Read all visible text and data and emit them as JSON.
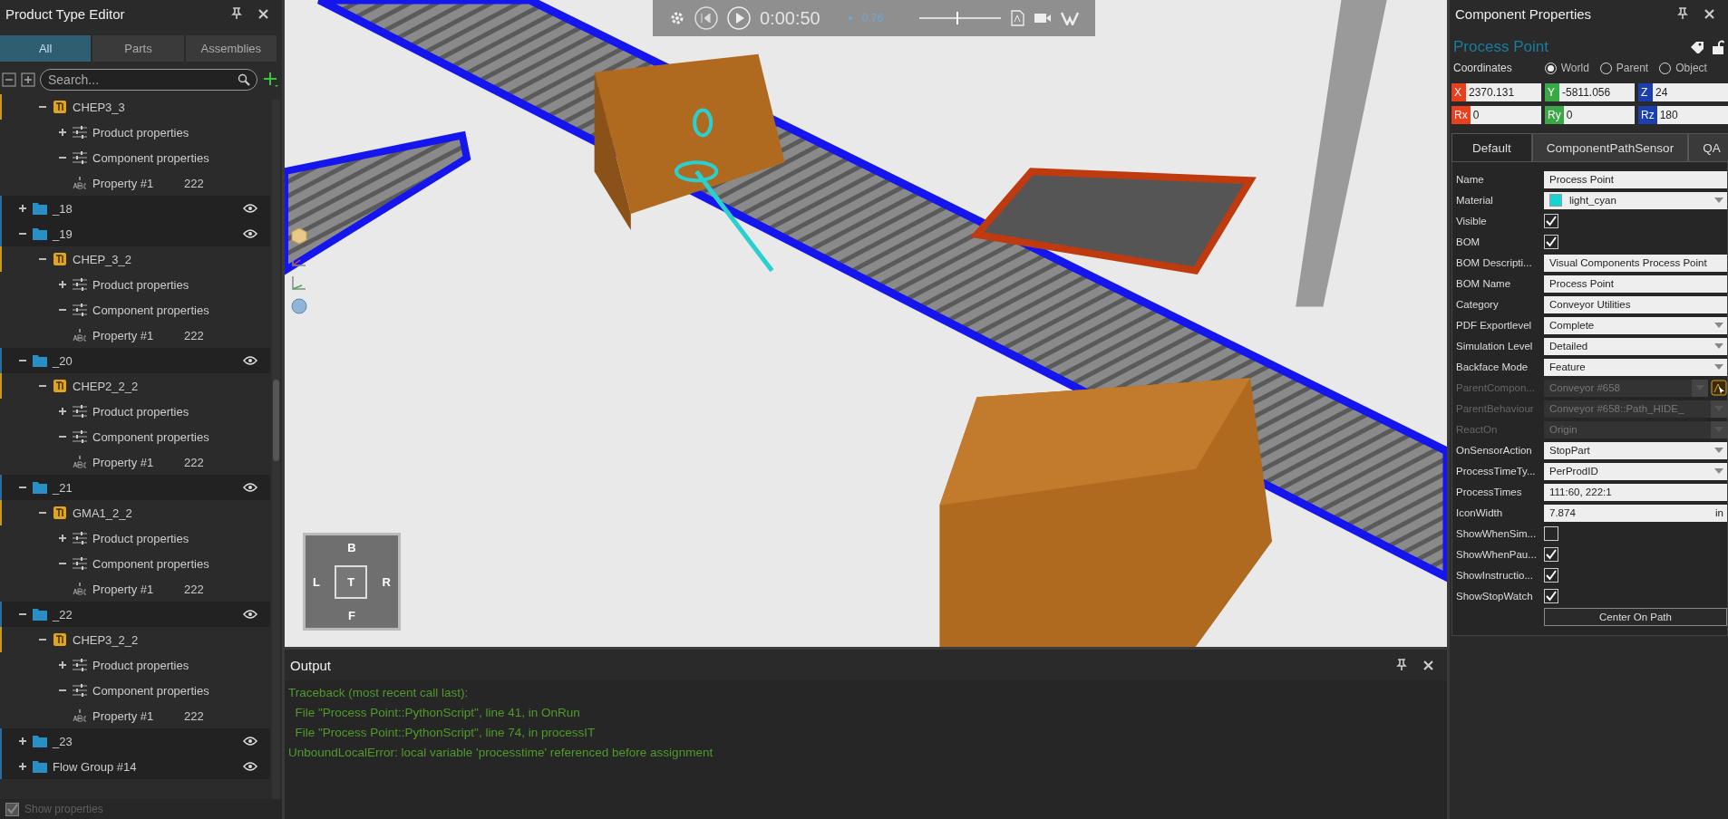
{
  "product_type_editor": {
    "title": "Product Type Editor",
    "tabs": [
      {
        "label": "All",
        "selected": true
      },
      {
        "label": "Parts",
        "selected": false
      },
      {
        "label": "Assemblies",
        "selected": false
      }
    ],
    "search": {
      "placeholder": "Search..."
    },
    "tree": [
      {
        "kind": "product",
        "label": "CHEP3_3",
        "expanded": true,
        "children": [
          {
            "kind": "group",
            "label": "Product properties",
            "expanded": false
          },
          {
            "kind": "group",
            "label": "Component properties",
            "expanded": true,
            "children": [
              {
                "kind": "property",
                "label": "Property #1",
                "value": "222"
              }
            ]
          }
        ]
      },
      {
        "kind": "folder",
        "label": "_18",
        "expanded": false
      },
      {
        "kind": "folder",
        "label": "_19",
        "expanded": true,
        "children": [
          {
            "kind": "product",
            "label": "CHEP_3_2",
            "expanded": true,
            "children": [
              {
                "kind": "group",
                "label": "Product properties",
                "expanded": false
              },
              {
                "kind": "group",
                "label": "Component properties",
                "expanded": true,
                "children": [
                  {
                    "kind": "property",
                    "label": "Property #1",
                    "value": "222"
                  }
                ]
              }
            ]
          }
        ]
      },
      {
        "kind": "folder",
        "label": "_20",
        "expanded": true,
        "children": [
          {
            "kind": "product",
            "label": "CHEP2_2_2",
            "expanded": true,
            "children": [
              {
                "kind": "group",
                "label": "Product properties",
                "expanded": false
              },
              {
                "kind": "group",
                "label": "Component properties",
                "expanded": true,
                "children": [
                  {
                    "kind": "property",
                    "label": "Property #1",
                    "value": "222"
                  }
                ]
              }
            ]
          }
        ]
      },
      {
        "kind": "folder",
        "label": "_21",
        "expanded": true,
        "children": [
          {
            "kind": "product",
            "label": "GMA1_2_2",
            "expanded": true,
            "children": [
              {
                "kind": "group",
                "label": "Product properties",
                "expanded": false
              },
              {
                "kind": "group",
                "label": "Component properties",
                "expanded": true,
                "children": [
                  {
                    "kind": "property",
                    "label": "Property #1",
                    "value": "222"
                  }
                ]
              }
            ]
          }
        ]
      },
      {
        "kind": "folder",
        "label": "_22",
        "expanded": true,
        "children": [
          {
            "kind": "product",
            "label": "CHEP3_2_2",
            "expanded": true,
            "children": [
              {
                "kind": "group",
                "label": "Product properties",
                "expanded": false
              },
              {
                "kind": "group",
                "label": "Component properties",
                "expanded": true,
                "children": [
                  {
                    "kind": "property",
                    "label": "Property #1",
                    "value": "222"
                  }
                ]
              }
            ]
          }
        ]
      },
      {
        "kind": "folder",
        "label": "_23",
        "expanded": false
      },
      {
        "kind": "folder",
        "label": "Flow Group #14",
        "expanded": false
      }
    ],
    "show_properties": {
      "label": "Show properties",
      "checked": true,
      "disabled": true
    }
  },
  "viewport": {
    "playback": {
      "time": "0:00:50",
      "speed": "0.76",
      "level": 0.45
    },
    "view_cube": {
      "top": "B",
      "left": "L",
      "center": "T",
      "right": "R",
      "bottom": "F"
    }
  },
  "output": {
    "title": "Output",
    "lines": [
      "Traceback (most recent call last):",
      "  File \"Process Point::PythonScript\", line 41, in OnRun",
      "  File \"Process Point::PythonScript\", line 74, in processIT",
      "UnboundLocalError: local variable 'processtime' referenced before assignment"
    ]
  },
  "component_properties": {
    "title": "Component Properties",
    "component_name": "Process Point",
    "coordinates": {
      "label": "Coordinates",
      "options": [
        {
          "label": "World",
          "selected": true
        },
        {
          "label": "Parent",
          "selected": false
        },
        {
          "label": "Object",
          "selected": false
        }
      ],
      "fields": [
        {
          "axis": "X",
          "value": "2370.131",
          "color": "#e8401c"
        },
        {
          "axis": "Y",
          "value": "-5811.056",
          "color": "#3aa845"
        },
        {
          "axis": "Z",
          "value": "24",
          "color": "#1c3fb0"
        },
        {
          "axis": "Rx",
          "value": "0",
          "color": "#e8401c"
        },
        {
          "axis": "Ry",
          "value": "0",
          "color": "#3aa845"
        },
        {
          "axis": "Rz",
          "value": "180",
          "color": "#1c3fb0"
        }
      ]
    },
    "tabs": [
      {
        "label": "Default",
        "selected": true
      },
      {
        "label": "ComponentPathSensor",
        "selected": false
      },
      {
        "label": "QA",
        "selected": false
      }
    ],
    "properties": [
      {
        "kind": "text",
        "label": "Name",
        "value": "Process Point",
        "disabled": false
      },
      {
        "kind": "dropdown",
        "label": "Material",
        "value": "light_cyan",
        "color": "#16d4d4",
        "disabled": false
      },
      {
        "kind": "checkbox",
        "label": "Visible",
        "checked": true
      },
      {
        "kind": "checkbox",
        "label": "BOM",
        "checked": true
      },
      {
        "kind": "text",
        "label": "BOM Descripti...",
        "value": "Visual Components Process Point",
        "disabled": false
      },
      {
        "kind": "text",
        "label": "BOM Name",
        "value": "Process Point",
        "disabled": false
      },
      {
        "kind": "text",
        "label": "Category",
        "value": "Conveyor Utilities",
        "disabled": false
      },
      {
        "kind": "dropdown",
        "label": "PDF Exportlevel",
        "value": "Complete",
        "disabled": false
      },
      {
        "kind": "dropdown",
        "label": "Simulation Level",
        "value": "Detailed",
        "disabled": false
      },
      {
        "kind": "dropdown",
        "label": "Backface Mode",
        "value": "Feature",
        "disabled": false
      },
      {
        "kind": "dropdown",
        "label": "ParentCompon...",
        "value": "Conveyor #658",
        "disabled": true,
        "picker": true
      },
      {
        "kind": "dropdown",
        "label": "ParentBehaviour",
        "value": "Conveyor #658::Path_HIDE_",
        "disabled": true
      },
      {
        "kind": "dropdown",
        "label": "ReactOn",
        "value": "Origin",
        "disabled": true
      },
      {
        "kind": "dropdown",
        "label": "OnSensorAction",
        "value": "StopPart",
        "disabled": false
      },
      {
        "kind": "dropdown",
        "label": "ProcessTimeTy...",
        "value": "PerProdID",
        "disabled": false
      },
      {
        "kind": "text",
        "label": "ProcessTimes",
        "value": "111:60, 222:1",
        "disabled": false
      },
      {
        "kind": "text",
        "label": "IconWidth",
        "value": "7.874",
        "unit": "in",
        "disabled": false
      },
      {
        "kind": "checkbox",
        "label": "ShowWhenSim...",
        "checked": false
      },
      {
        "kind": "checkbox",
        "label": "ShowWhenPau...",
        "checked": true
      },
      {
        "kind": "checkbox",
        "label": "ShowInstructio...",
        "checked": true
      },
      {
        "kind": "checkbox",
        "label": "ShowStopWatch",
        "checked": true
      },
      {
        "kind": "button",
        "label": "Center On Path"
      }
    ]
  }
}
